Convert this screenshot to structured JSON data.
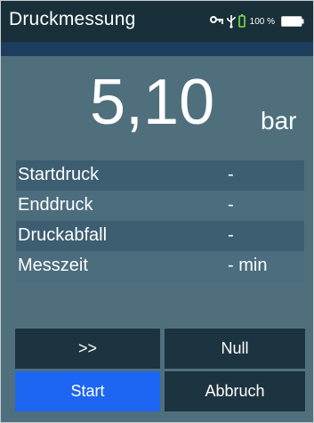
{
  "header": {
    "title": "Druckmessung",
    "icons": [
      "key-icon",
      "usb-icon",
      "battery-plug-icon",
      "battery-icon"
    ],
    "battery_text": "100 %"
  },
  "reading": {
    "value": "5,10",
    "unit": "bar"
  },
  "table": {
    "rows": [
      {
        "label": "Startdruck",
        "value": "-"
      },
      {
        "label": "Enddruck",
        "value": "-"
      },
      {
        "label": "Druckabfall",
        "value": "-"
      },
      {
        "label": "Messzeit",
        "value": "- min"
      }
    ]
  },
  "buttons": {
    "next": ">>",
    "null": "Null",
    "start": "Start",
    "cancel": "Abbruch"
  },
  "colors": {
    "title_bar": "#19303a",
    "panel": "#4f6f7d",
    "accent_line": "#1d3d5e",
    "button_dark": "#1c3340",
    "button_active": "#1d66f2"
  }
}
